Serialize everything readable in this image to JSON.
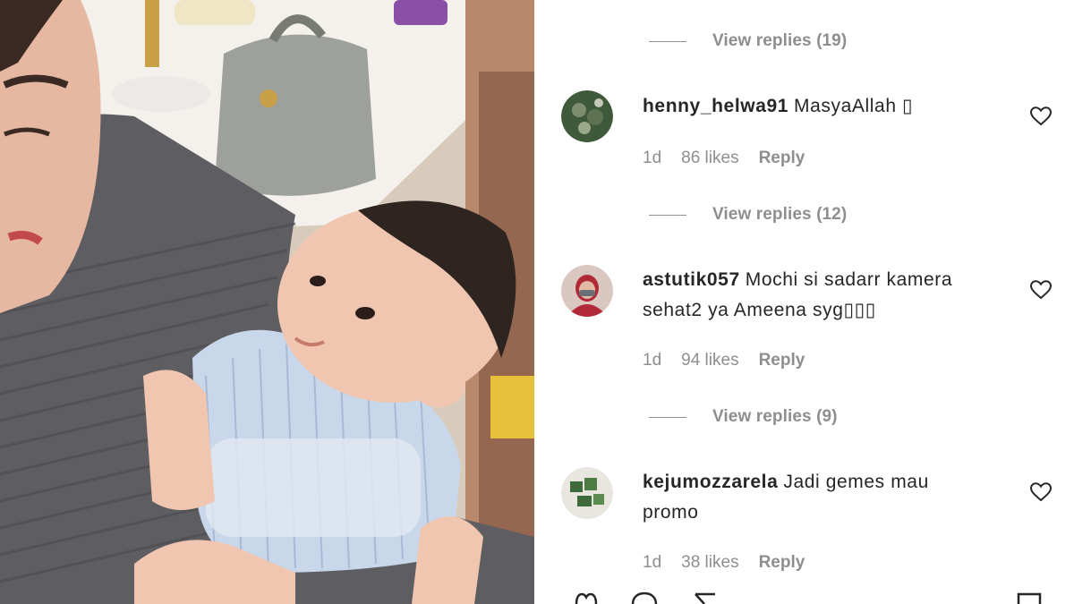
{
  "post_image": {
    "alt_icon": "photo-of-baby-icon"
  },
  "comments": [
    {
      "view_replies": "View replies (19)"
    },
    {
      "username": "henny_helwa91",
      "text": "MasyaAllah ▯",
      "age": "1d",
      "likes": "86 likes",
      "reply": "Reply",
      "view_replies": "View replies (12)",
      "avatar_colors": [
        "#3f5a3a",
        "#7d8d6e"
      ]
    },
    {
      "username": "astutik057",
      "text_line1": "Mochi si sadarr kamera",
      "text_line2": "sehat2 ya Ameena syg▯▯▯",
      "age": "1d",
      "likes": "94 likes",
      "reply": "Reply",
      "view_replies": "View replies (9)",
      "avatar_colors": [
        "#b22a3a",
        "#d9c7c0"
      ]
    },
    {
      "username": "kejumozzarela",
      "text_line1": "Jadi gemes mau",
      "text_line2": "promo",
      "age": "1d",
      "likes": "38 likes",
      "reply": "Reply",
      "avatar_colors": [
        "#e8e6df",
        "#3e6b3a"
      ]
    }
  ],
  "icons": {
    "like": "heart-icon",
    "comment": "comment-icon",
    "share": "share-icon",
    "save": "bookmark-icon"
  },
  "colors": {
    "muted": "#8e8e8e",
    "text": "#262626"
  }
}
